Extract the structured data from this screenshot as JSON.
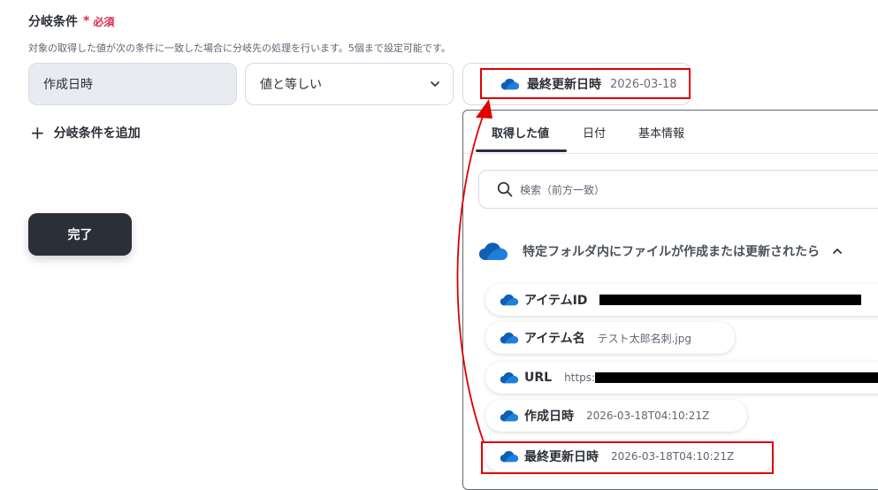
{
  "header": {
    "title": "分岐条件",
    "required_mark": "*",
    "required_text": "必須",
    "description": "対象の取得した値が次の条件に一致した場合に分岐先の処理を行います。5個まで設定可能です。"
  },
  "condition": {
    "field_value": "作成日時",
    "operator_value": "値と等しい",
    "value_name": "最終更新日時",
    "value_text": "2026-03-18"
  },
  "add_condition_label": "分岐条件を追加",
  "plus_glyph": "+",
  "done_label": "完了",
  "panel": {
    "tabs": [
      {
        "label": "取得した値",
        "active": true
      },
      {
        "label": "日付",
        "active": false
      },
      {
        "label": "基本情報",
        "active": false
      }
    ],
    "search_placeholder": "検索（前方一致）",
    "group_title": "特定フォルダ内にファイルが作成または更新されたら",
    "items": [
      {
        "name": "アイテムID",
        "value": ""
      },
      {
        "name": "アイテム名",
        "value": "テスト太郎名刺.jpg"
      },
      {
        "name": "URL",
        "value": "https:"
      },
      {
        "name": "作成日時",
        "value": "2026-03-18T04:10:21Z"
      },
      {
        "name": "最終更新日時",
        "value": "2026-03-18T04:10:21Z"
      }
    ]
  },
  "colors": {
    "accent_red": "#e0284f",
    "annotation_red": "#e00000",
    "dark_button": "#2a2f38",
    "onedrive_blue": "#1b78d4"
  },
  "icons": [
    "onedrive-cloud-icon",
    "chevron-down-icon",
    "chevron-up-icon",
    "plus-icon",
    "search-icon"
  ]
}
